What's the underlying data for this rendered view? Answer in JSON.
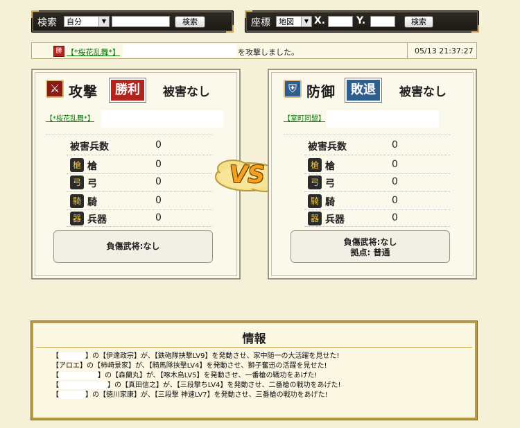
{
  "search_bar": {
    "label": "検索",
    "scope_value": "自分",
    "button": "検索"
  },
  "coord_bar": {
    "label": "座標",
    "map_value": "地図",
    "x_label": "X.",
    "y_label": "Y.",
    "button": "検索"
  },
  "message": {
    "win_icon": "勝",
    "attacker": "【*桜花乱舞*】",
    "text": "を攻撃しました。",
    "timestamp": "05/13 21:37:27"
  },
  "attack": {
    "title": "攻撃",
    "result": "勝利",
    "damage_status": "被害なし",
    "alliance": "【*桜花乱舞*】",
    "stats_label": "被害兵数",
    "stats_total": "0",
    "units": [
      {
        "icon": "spear-icon",
        "label": "槍",
        "value": "0"
      },
      {
        "icon": "bow-icon",
        "label": "弓",
        "value": "0"
      },
      {
        "icon": "horse-icon",
        "label": "騎",
        "value": "0"
      },
      {
        "icon": "weapon-icon",
        "label": "兵器",
        "value": "0"
      }
    ],
    "casualty": "負傷武将:なし"
  },
  "vs": "VS",
  "defense": {
    "title": "防御",
    "result": "敗退",
    "damage_status": "被害なし",
    "alliance": "【室町同盟】",
    "stats_label": "被害兵数",
    "stats_total": "0",
    "units": [
      {
        "icon": "spear-icon",
        "label": "槍",
        "value": "0"
      },
      {
        "icon": "bow-icon",
        "label": "弓",
        "value": "0"
      },
      {
        "icon": "horse-icon",
        "label": "騎",
        "value": "0"
      },
      {
        "icon": "weapon-icon",
        "label": "兵器",
        "value": "0"
      }
    ],
    "casualty": "負傷武将:なし",
    "base": "拠点: 普通"
  },
  "info": {
    "title": "情報",
    "lines": [
      {
        "pre": "【",
        "name": "",
        "post": "】の【伊達政宗】が、【鉄砲隊挟撃LV9】を発動させ、家中随一の大活躍を見せた!"
      },
      {
        "pre": "【",
        "name": "アロエ",
        "post": "】の【柿崎景家】が、【騎馬隊挟撃LV4】を発動させ、獅子奮迅の活躍を見せた!"
      },
      {
        "pre": "【",
        "name": "",
        "post": "】の【森蘭丸】が、【啄木鳥LV5】を発動させ、一番槍の戦功をあげた!"
      },
      {
        "pre": "【",
        "name": "",
        "post": "】の【真田信之】が、【三段撃ちLV4】を発動させ、二番槍の戦功をあげた!"
      },
      {
        "pre": "【",
        "name": "",
        "post": "】の【徳川家康】が、【三段撃 神速LV7】を発動させ、三番槍の戦功をあげた!"
      }
    ]
  },
  "colors": {
    "win": "#b3241c",
    "lose": "#2f5f8e",
    "gold": "#b99a3c"
  }
}
